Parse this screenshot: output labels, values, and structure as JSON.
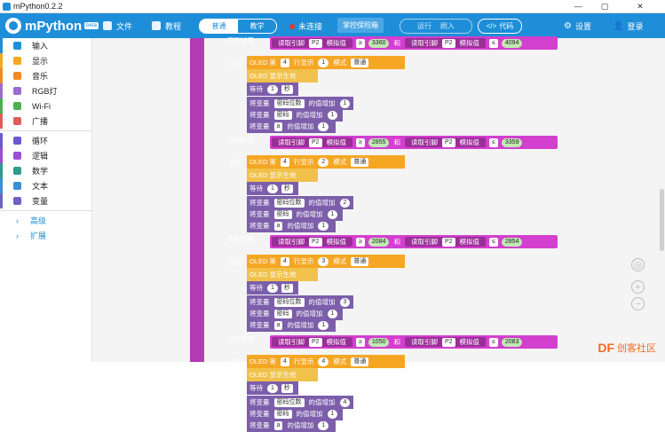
{
  "window": {
    "title": "mPython0.2.2",
    "minimize": "—",
    "restore": "▢",
    "close": "✕"
  },
  "topbar": {
    "brand": "mPython",
    "brand_badge": "beta",
    "file": "文件",
    "tutorial": "教程",
    "mode_normal": "普通",
    "mode_teach": "教学",
    "connection": "未连接",
    "project_name": "掌控保险箱",
    "run": "运行",
    "flash": "刷入",
    "code": "代码",
    "settings": "设置",
    "login": "登录",
    "colors": {
      "primary": "#1e8ed8",
      "status_dot": "#e53935"
    }
  },
  "sidebar": {
    "categories": [
      {
        "label": "输入",
        "color": "#1e8ed8"
      },
      {
        "label": "显示",
        "color": "#f5a623"
      },
      {
        "label": "音乐",
        "color": "#f08a24"
      },
      {
        "label": "RGB灯",
        "color": "#9c6bd1"
      },
      {
        "label": "Wi-Fi",
        "color": "#4caf50"
      },
      {
        "label": "广播",
        "color": "#e05c5c"
      },
      {
        "label": "循环",
        "color": "#6a5acd"
      },
      {
        "label": "逻辑",
        "color": "#9c4dd1"
      },
      {
        "label": "数学",
        "color": "#2e9b8f"
      },
      {
        "label": "文本",
        "color": "#3a8fd6"
      },
      {
        "label": "变量",
        "color": "#6c63c9"
      }
    ],
    "expanders": [
      "高级",
      "扩展"
    ]
  },
  "code": {
    "else_if": "否则如果",
    "do": "执行",
    "and": "和",
    "read_pin": "读取引脚",
    "pin": "P2",
    "analog": "模拟值",
    "oled_row_prefix": "OLED 第",
    "row_show": "行显示",
    "mode": "模式",
    "mode_val": "普通",
    "oled_apply": "OLED 显示生效",
    "wait": "等待",
    "wait_unit": "秒",
    "set_var": "将变量",
    "inc_by": "的值增加",
    "var_count": "密码位数",
    "var_pwd": "密码",
    "var_a": "a",
    "row_num": "4",
    "inc_one": "1",
    "wait_val": "1",
    "groups": [
      {
        "op1": "≥",
        "lo": "3360",
        "op2": "≤",
        "hi": "4094",
        "digit": "1",
        "count_inc": "1"
      },
      {
        "op1": "≥",
        "lo": "2855",
        "op2": "≤",
        "hi": "3359",
        "digit": "2",
        "count_inc": "2"
      },
      {
        "op1": "≥",
        "lo": "2084",
        "op2": "≤",
        "hi": "2854",
        "digit": "3",
        "count_inc": "3"
      },
      {
        "op1": "≥",
        "lo": "1050",
        "op2": "≤",
        "hi": "2083",
        "digit": "4",
        "count_inc": "4"
      }
    ]
  },
  "watermark": {
    "brand": "DF",
    "text": "创客社区"
  }
}
